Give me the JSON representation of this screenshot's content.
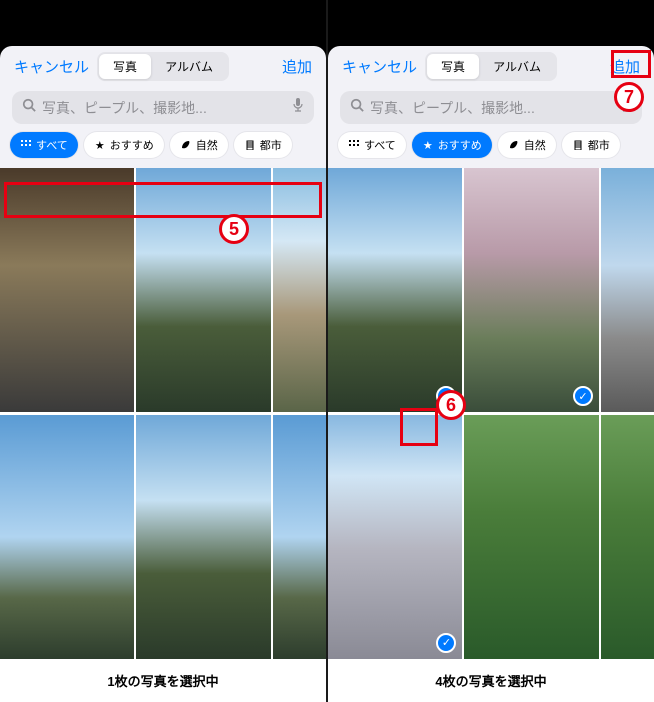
{
  "left": {
    "cancel": "キャンセル",
    "add": "追加",
    "segments": {
      "photos": "写真",
      "albums": "アルバム"
    },
    "search_placeholder": "写真、ピープル、撮影地...",
    "filters": {
      "all": "すべて",
      "recommended": "おすすめ",
      "nature": "自然",
      "city": "都市"
    },
    "footer": "1枚の写真を選択中"
  },
  "right": {
    "cancel": "キャンセル",
    "add": "追加",
    "segments": {
      "photos": "写真",
      "albums": "アルバム"
    },
    "search_placeholder": "写真、ピープル、撮影地...",
    "filters": {
      "all": "すべて",
      "recommended": "おすすめ",
      "nature": "自然",
      "city": "都市"
    },
    "footer": "4枚の写真を選択中"
  },
  "annotations": {
    "step5": "5",
    "step6": "6",
    "step7": "7"
  },
  "colors": {
    "accent": "#007aff",
    "annotation": "#e60012"
  }
}
